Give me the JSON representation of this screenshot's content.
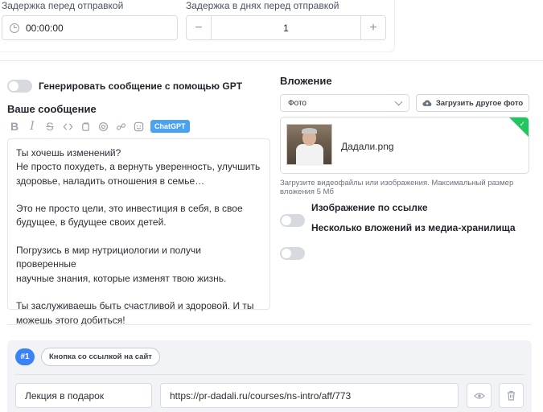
{
  "delay": {
    "send_delay_label": "Задержка перед отправкой",
    "send_delay_value": "00:00:00",
    "days_delay_label": "Задержка в днях перед отправкой",
    "days_delay_value": "1",
    "minus": "−",
    "plus": "+"
  },
  "gpt_toggle": {
    "label": "Генерировать сообщение с помощью GPT",
    "on": false
  },
  "message": {
    "title": "Ваше сообщение",
    "chatgpt_badge": "ChatGPT",
    "toolbar_icons": [
      "bold-icon",
      "italic-icon",
      "strikethrough-icon",
      "code-icon",
      "copy-icon",
      "mention-icon",
      "link-icon",
      "emoji-icon"
    ],
    "text": {
      "p1l1": "Ты хочешь изменений?",
      "p1l2": "Не просто похудеть, а вернуть уверенность, улучшить",
      "p1l3": "здоровье, наладить отношения в семье…",
      "p2l1": "Это не просто цели, это инвестиция в себя, в свое",
      "p2l2": "будущее, в будущее своих детей.",
      "p3l1": "Погрузись в мир нутрициологии и получи проверенные",
      "p3l2": "научные знания, которые изменят твою жизнь.",
      "p4l1": "Ты заслуживаешь быть счастливой и здоровой. И ты",
      "p4l2": "можешь этого добиться!"
    }
  },
  "attachment": {
    "title": "Вложение",
    "type_select": "Фото",
    "upload_button": "Загрузить другое фото",
    "file_name": "Дадали.png",
    "hint": "Загрузите видеофайлы или изображения. Максимальный размер вложения 5 Мб",
    "toggle_url_label": "Изображение по ссылке",
    "toggle_media_label": "Несколько вложений из медиа-хранилища"
  },
  "buttons_section": {
    "number": "#1",
    "type_chip": "Кнопка со ссылкой на сайт",
    "button_text": "Лекция в подарок",
    "button_url": "https://pr-dadali.ru/courses/ns-intro/aff/773"
  },
  "colors": {
    "accent": "#3b82f6",
    "chatgpt": "#4aa3f2",
    "success": "#22c55e"
  }
}
